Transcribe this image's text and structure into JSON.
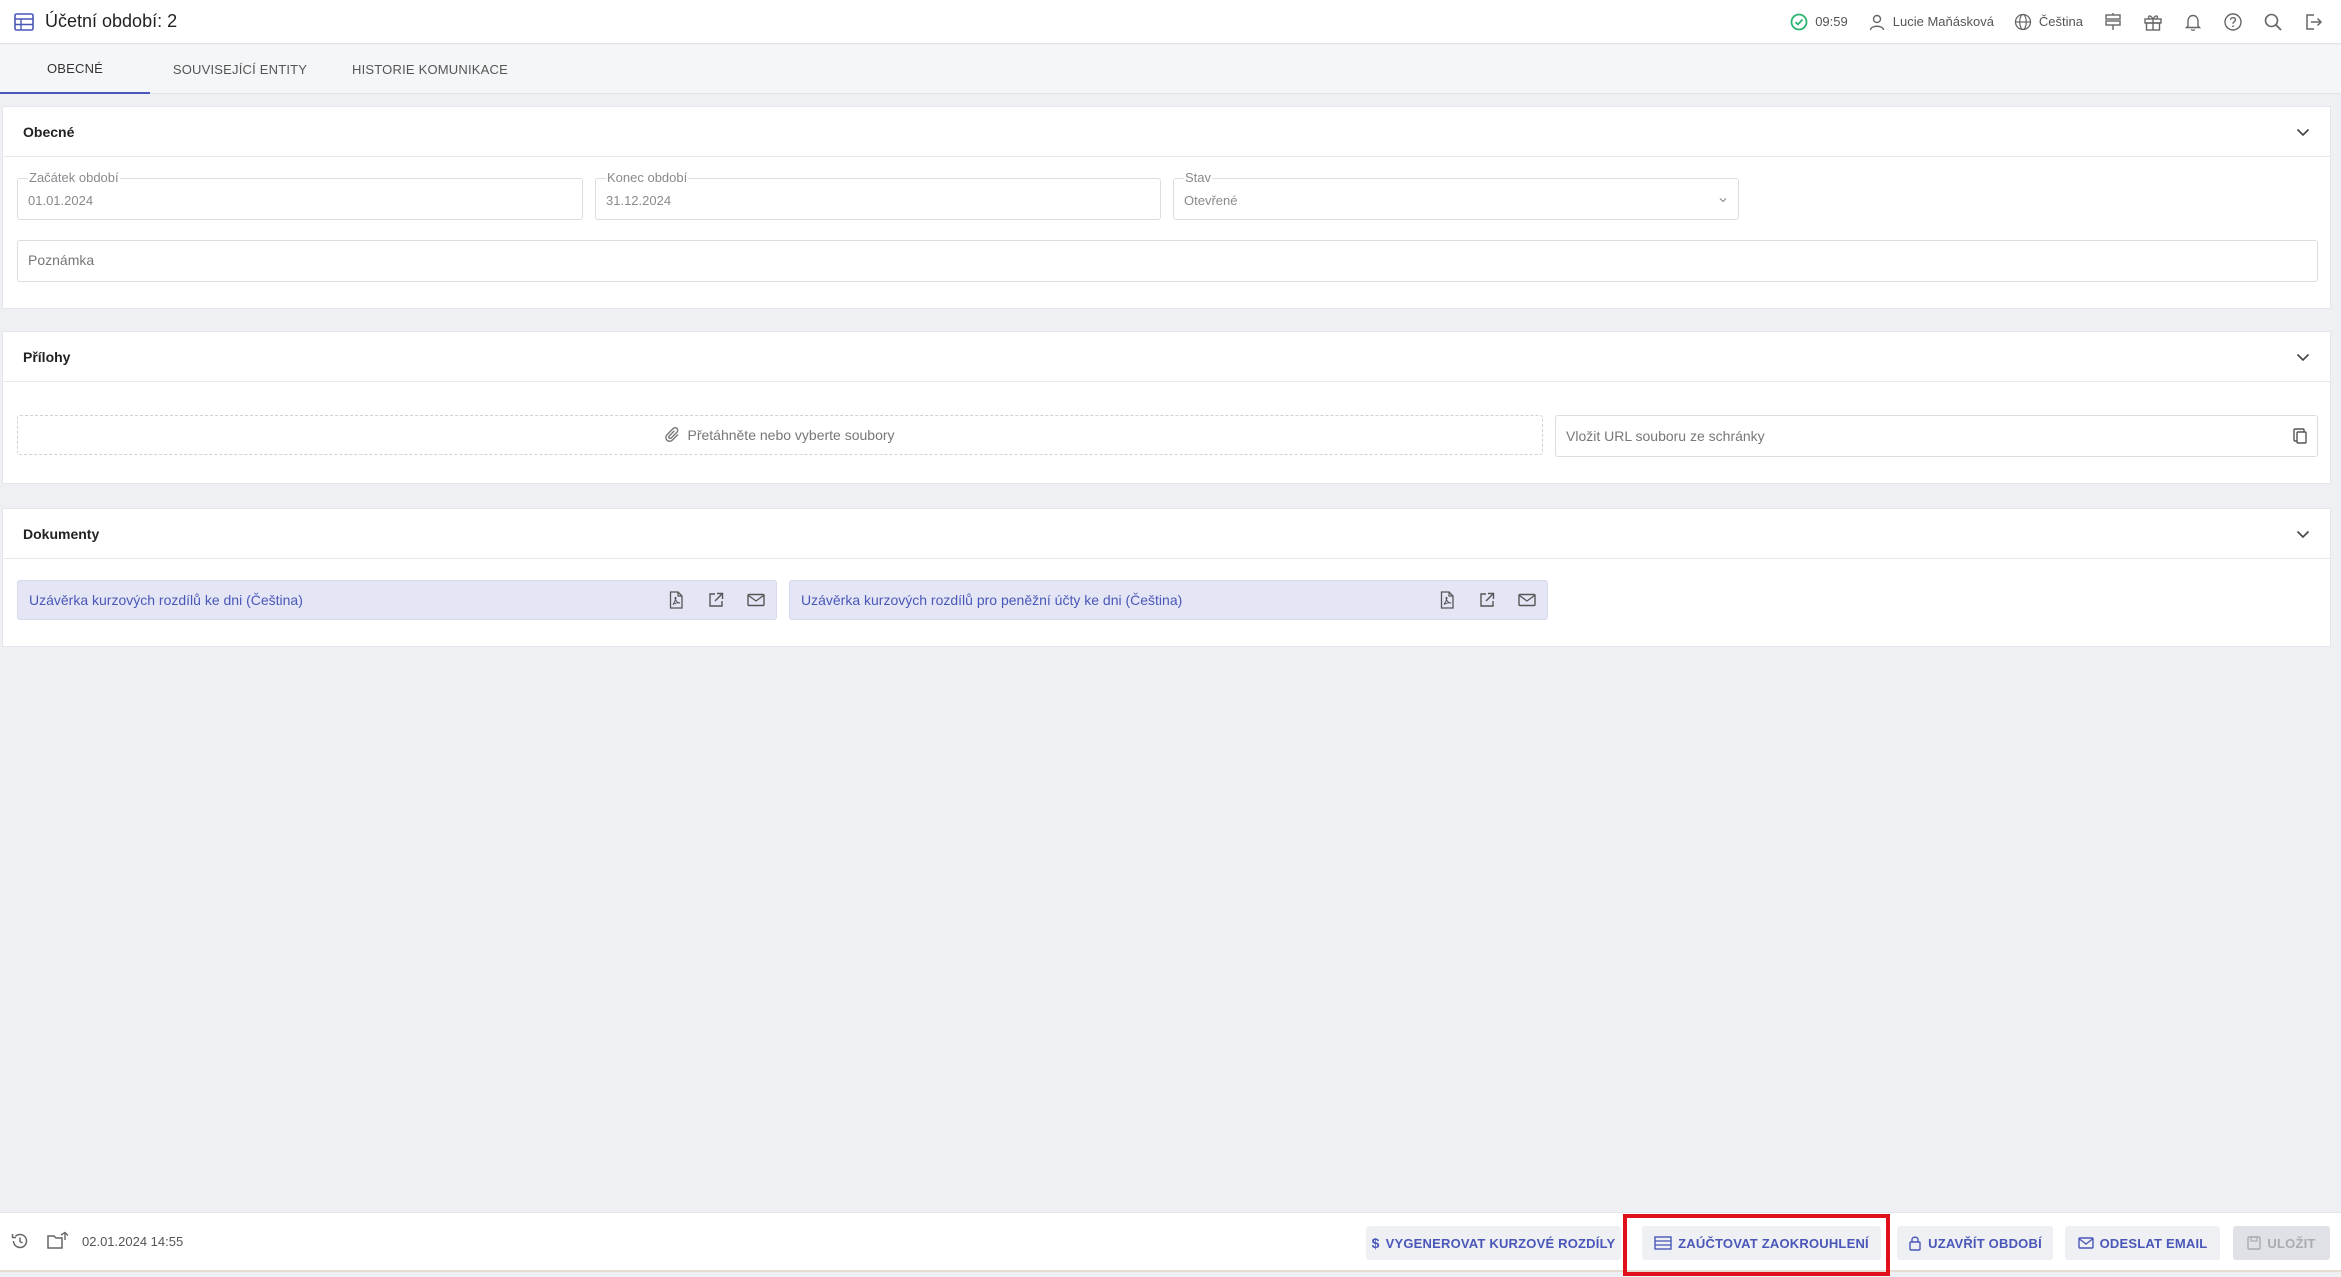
{
  "header": {
    "title": "Účetní období: 2",
    "time": "09:59",
    "user": "Lucie Maňásková",
    "language": "Čeština"
  },
  "tabs": [
    {
      "label": "OBECNÉ"
    },
    {
      "label": "SOUVISEJÍCÍ ENTITY"
    },
    {
      "label": "HISTORIE KOMUNIKACE"
    }
  ],
  "general": {
    "title": "Obecné",
    "start_label": "Začátek období",
    "start_value": "01.01.2024",
    "end_label": "Konec období",
    "end_value": "31.12.2024",
    "status_label": "Stav",
    "status_value": "Otevřené",
    "note_placeholder": "Poznámka"
  },
  "attachments": {
    "title": "Přílohy",
    "dropzone": "Přetáhněte nebo vyberte soubory",
    "url_placeholder": "Vložit URL souboru ze schránky"
  },
  "documents": {
    "title": "Dokumenty",
    "items": [
      {
        "name": "Uzávěrka kurzových rozdílů ke dni (Čeština)"
      },
      {
        "name": "Uzávěrka kurzových rozdílů pro peněžní účty ke dni (Čeština)"
      }
    ]
  },
  "footer": {
    "timestamp": "02.01.2024 14:55",
    "buttons": {
      "generate": "VYGENEROVAT KURZOVÉ ROZDÍLY",
      "post_rounding": "ZAÚČTOVAT ZAOKROUHLENÍ",
      "close_period": "UZAVŘÍT OBDOBÍ",
      "send_email": "ODESLAT EMAIL",
      "save": "ULOŽIT"
    }
  },
  "colors": {
    "accent": "#4a57b8",
    "success": "#2bb673",
    "highlight": "#e0101a"
  }
}
